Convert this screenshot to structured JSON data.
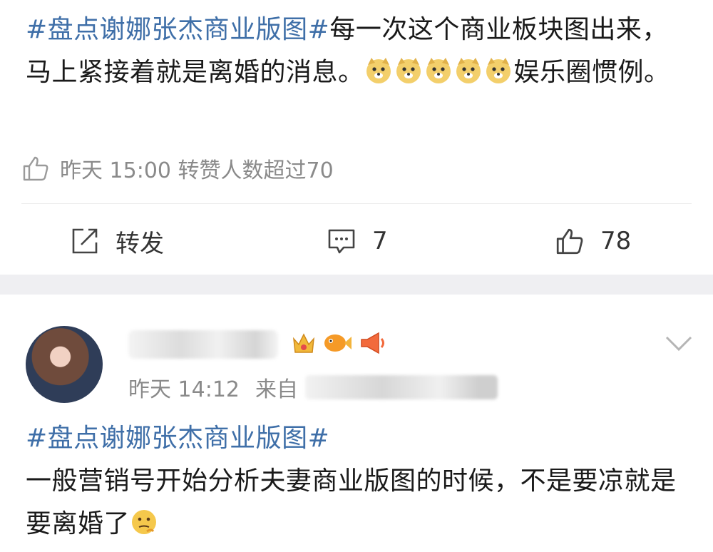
{
  "post1": {
    "hashtag": "#盘点谢娜张杰商业版图#",
    "text_a": "每一次这个商业板块图出来，马上紧接着就是离婚的消息。",
    "text_b": "娱乐圈惯例。",
    "emoji_icons": [
      "doge-emoji",
      "doge-emoji",
      "doge-emoji",
      "doge-emoji",
      "doge-emoji"
    ],
    "meta": "昨天 15:00 转赞人数超过70",
    "actions": {
      "repost_label": "转发",
      "comment_count": "7",
      "like_count": "78"
    }
  },
  "post2": {
    "time": "昨天 14:12",
    "source_prefix": "来自",
    "hashtag": "#盘点谢娜张杰商业版图#",
    "text": "一般营销号开始分析夫妻商业版图的时候，不是要凉就是要离婚了",
    "end_emoji": "thinking-emoji",
    "badge_icons": [
      "crown-badge-icon",
      "fish-badge-icon",
      "megaphone-badge-icon"
    ]
  },
  "colors": {
    "hashtag": "#3f6fa8",
    "meta_gray": "#8a8a8a",
    "separator": "#efeff2"
  }
}
